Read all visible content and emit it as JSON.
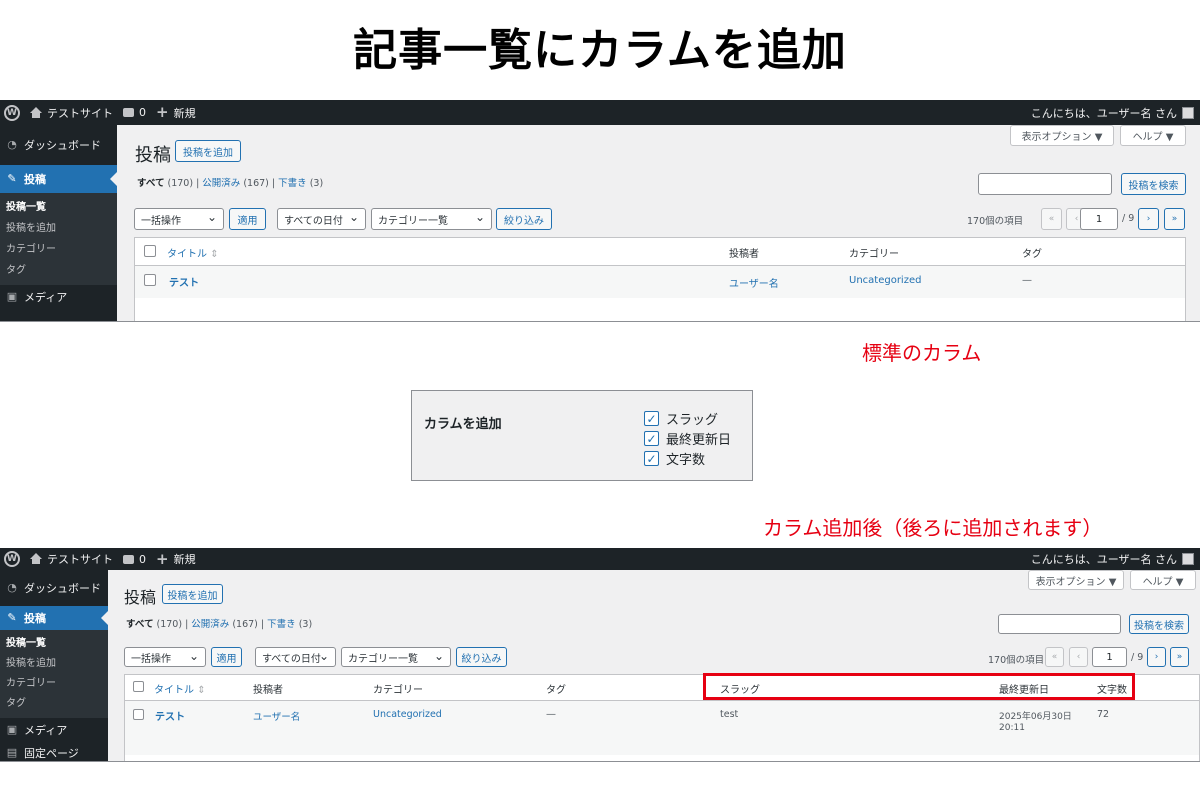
{
  "heading": "記事一覧にカラムを追加",
  "label_standard": "標準のカラム",
  "label_after": "カラム追加後（後ろに追加されます）",
  "adminbar": {
    "site_name": "テストサイト",
    "comments": "0",
    "new": "新規",
    "greeting": "こんにちは、ユーザー名 さん"
  },
  "sidebar": {
    "dashboard": "ダッシュボード",
    "posts": "投稿",
    "sub_all": "投稿一覧",
    "sub_add": "投稿を追加",
    "sub_category": "カテゴリー",
    "sub_tag": "タグ",
    "media": "メディア",
    "pages": "固定ページ"
  },
  "screen": {
    "title": "投稿",
    "add_new": "投稿を追加",
    "screen_options": "表示オプション ▼",
    "help": "ヘルプ ▼",
    "filter_all": "すべて",
    "filter_all_count": "(170)",
    "filter_published": "公開済み",
    "filter_published_count": "(167)",
    "filter_draft": "下書き",
    "filter_draft_count": "(3)",
    "search_button": "投稿を検索",
    "bulk_action": "一括操作",
    "apply": "適用",
    "all_dates": "すべての日付",
    "category_list": "カテゴリー一覧",
    "filter": "絞り込み",
    "items_count": "170個の項目",
    "page_current": "1",
    "page_total": "/ 9",
    "first": "«",
    "prev": "‹",
    "next": "›",
    "last": "»"
  },
  "columns": {
    "title": "タイトル",
    "sort": "⇕",
    "author": "投稿者",
    "category": "カテゴリー",
    "tag": "タグ",
    "slug": "スラッグ",
    "modified": "最終更新日",
    "wordcount": "文字数"
  },
  "row": {
    "title": "テスト",
    "author": "ユーザー名",
    "category": "Uncategorized",
    "tag": "—",
    "slug": "test",
    "modified_date": "2025年06月30日",
    "modified_time": "20:11",
    "wordcount": "72"
  },
  "options_box": {
    "title": "カラムを追加",
    "items": [
      "スラッグ",
      "最終更新日",
      "文字数"
    ],
    "checked": [
      true,
      true,
      true
    ]
  },
  "colors": {
    "admin_dark": "#1d2327",
    "accent": "#2271b1",
    "highlight": "#e60012"
  }
}
